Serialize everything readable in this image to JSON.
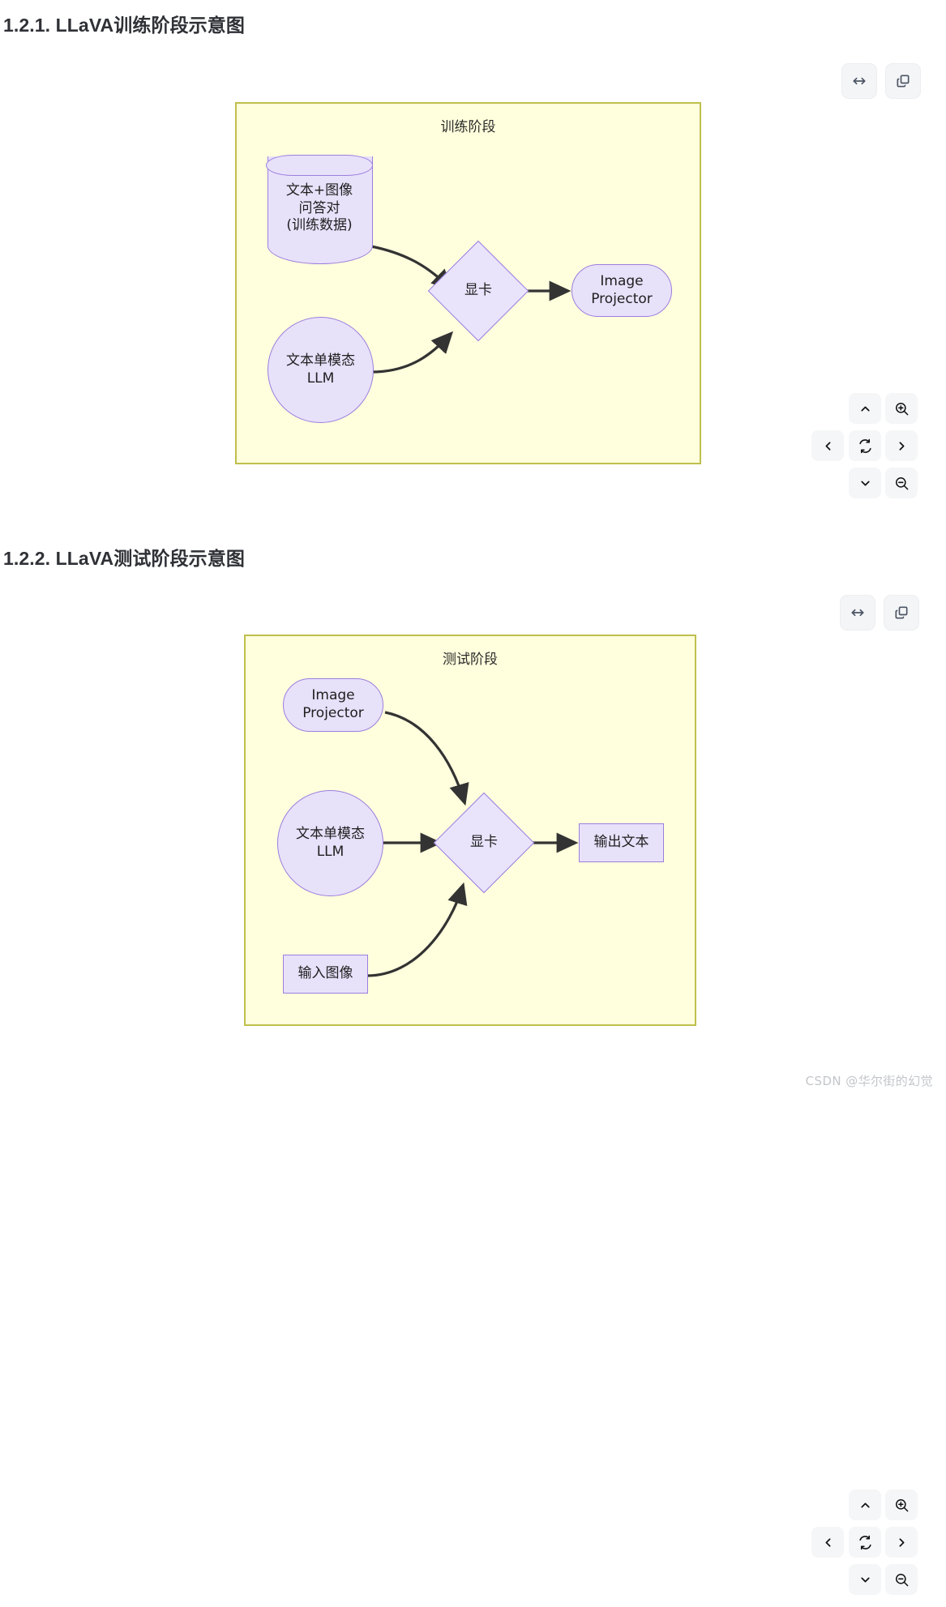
{
  "page": {
    "watermark": "CSDN @华尔街的幻觉",
    "background": "#ffffff"
  },
  "colors": {
    "frame_fill": "#ffffdd",
    "frame_border": "#bfbf4d",
    "node_fill": "#e8e1fa",
    "node_border": "#9b7ede",
    "diamond_fill": "#e9e4fc",
    "edge_stroke": "#333333",
    "toolbar_bg": "#f4f5f7",
    "icon_stroke": "#4b5563",
    "heading_color": "#2f3136",
    "watermark_color": "#c3c6ca"
  },
  "sections": [
    {
      "heading": "1.2.1. LLaVA训练阶段示意图",
      "toolbar": {
        "fit_width_label": "fit-width",
        "copy_label": "copy"
      },
      "navpad": {
        "up_label": "pan-up",
        "down_label": "pan-down",
        "left_label": "pan-left",
        "right_label": "pan-right",
        "reset_label": "reset",
        "zoom_in_label": "zoom-in",
        "zoom_out_label": "zoom-out"
      },
      "diagram": {
        "title": "训练阶段",
        "nodes": [
          {
            "id": "data",
            "shape": "cylinder",
            "label": "文本+图像\n问答对\n(训练数据)"
          },
          {
            "id": "llm",
            "shape": "circle",
            "label": "文本单模态\nLLM"
          },
          {
            "id": "gpu",
            "shape": "diamond",
            "label": "显卡"
          },
          {
            "id": "projector",
            "shape": "stadium",
            "label": "Image\nProjector"
          }
        ],
        "edges": [
          {
            "from": "data",
            "to": "gpu",
            "style": "curved"
          },
          {
            "from": "llm",
            "to": "gpu",
            "style": "curved"
          },
          {
            "from": "gpu",
            "to": "projector",
            "style": "straight"
          }
        ]
      }
    },
    {
      "heading": "1.2.2. LLaVA测试阶段示意图",
      "toolbar": {
        "fit_width_label": "fit-width",
        "copy_label": "copy"
      },
      "navpad": {
        "up_label": "pan-up",
        "down_label": "pan-down",
        "left_label": "pan-left",
        "right_label": "pan-right",
        "reset_label": "reset",
        "zoom_in_label": "zoom-in",
        "zoom_out_label": "zoom-out"
      },
      "diagram": {
        "title": "测试阶段",
        "nodes": [
          {
            "id": "projector",
            "shape": "stadium",
            "label": "Image\nProjector"
          },
          {
            "id": "llm",
            "shape": "circle",
            "label": "文本单模态\nLLM"
          },
          {
            "id": "inimg",
            "shape": "rect",
            "label": "输入图像"
          },
          {
            "id": "gpu",
            "shape": "diamond",
            "label": "显卡"
          },
          {
            "id": "outtext",
            "shape": "rect",
            "label": "输出文本"
          }
        ],
        "edges": [
          {
            "from": "projector",
            "to": "gpu",
            "style": "curved"
          },
          {
            "from": "llm",
            "to": "gpu",
            "style": "straight"
          },
          {
            "from": "inimg",
            "to": "gpu",
            "style": "curved"
          },
          {
            "from": "gpu",
            "to": "outtext",
            "style": "straight"
          }
        ]
      }
    }
  ]
}
